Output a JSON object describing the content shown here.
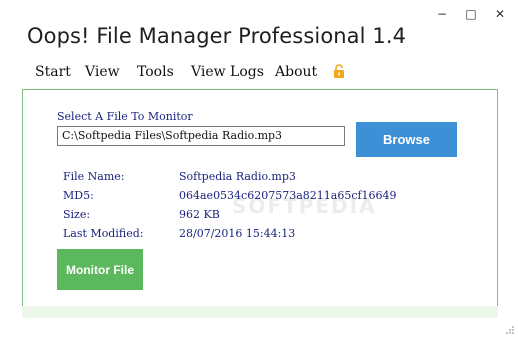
{
  "window": {
    "title": "Oops! File Manager Professional 1.4",
    "controls": {
      "minimize": "−",
      "maximize": "□",
      "close": "✕"
    }
  },
  "menu": {
    "items": [
      "Start",
      "View",
      "Tools",
      "View Logs",
      "About"
    ],
    "lock_icon": "lock-icon"
  },
  "monitor": {
    "select_label": "Select A File To Monitor",
    "file_path": "C:\\Softpedia Files\\Softpedia Radio.mp3",
    "browse_label": "Browse",
    "button_label": "Monitor File"
  },
  "details": {
    "labels": {
      "file_name": "File Name:",
      "md5": "MD5:",
      "size": "Size:",
      "last_modified": "Last Modified:"
    },
    "values": {
      "file_name": "Softpedia Radio.mp3",
      "md5": "064ae0534c6207573a8211a65cf16649",
      "size": "962 KB",
      "last_modified": "28/07/2016 15:44:13"
    }
  },
  "watermark": "SOFTPEDIA",
  "colors": {
    "browse_button": "#3d8fd6",
    "monitor_button": "#5cb85c",
    "panel_border": "#7bbf7b",
    "label_text": "#1a237e",
    "lock_icon": "#f2a71b"
  }
}
